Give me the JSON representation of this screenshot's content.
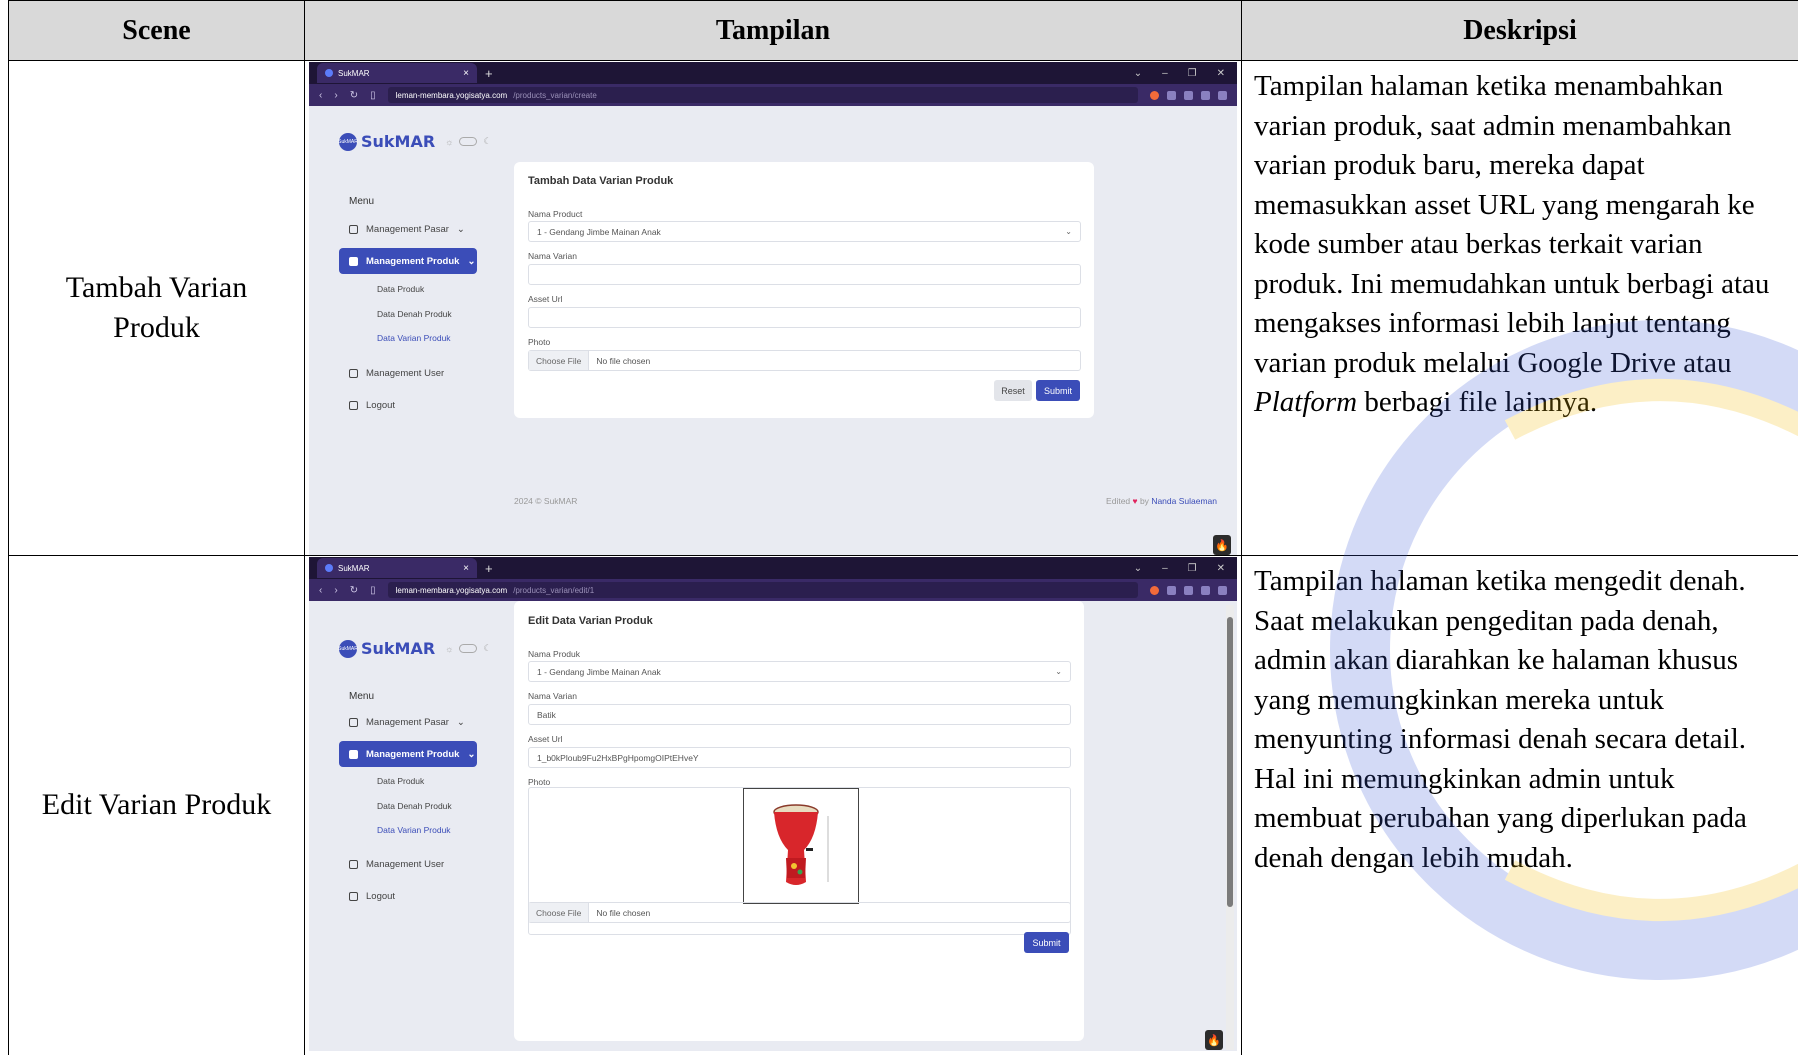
{
  "table": {
    "headers": {
      "scene": "Scene",
      "view": "Tampilan",
      "description": "Deskripsi"
    },
    "rows": [
      {
        "scene": "Tambah Varian Produk",
        "description_parts": [
          "Tampilan halaman ketika menambahkan varian produk, saat admin menambahkan varian produk baru, mereka dapat memasukkan asset URL yang mengarah ke kode sumber atau berkas terkait varian produk. Ini memudahkan untuk berbagi atau mengakses informasi lebih lanjut tentang varian produk melalui Google Drive atau ",
          "Platform",
          " berbagi file lainnya."
        ],
        "screenshot": {
          "tab_title": "SukMAR",
          "url_host": "leman-membara.yogisatya.com",
          "url_path": "/products_varian/create",
          "logo": "SukMAR",
          "menu_title": "Menu",
          "nav": [
            "Management Pasar",
            "Management Produk",
            "Management User",
            "Logout"
          ],
          "subnav": [
            "Data Produk",
            "Data Denah Produk",
            "Data Varian Produk"
          ],
          "card_title": "Tambah Data Varian Produk",
          "labels": [
            "Nama Product",
            "Nama Varian",
            "Asset Url",
            "Photo"
          ],
          "product_value": "1 - Gendang Jimbe Mainan Anak",
          "file_button": "Choose File",
          "file_status": "No file chosen",
          "reset_label": "Reset",
          "submit_label": "Submit",
          "footer_left": "2024 © SukMAR",
          "footer_edited": "Edited",
          "footer_by": "by",
          "footer_author": "Nanda Sulaeman"
        }
      },
      {
        "scene": "Edit Varian Produk",
        "description": "Tampilan halaman ketika mengedit denah. Saat melakukan pengeditan pada denah, admin akan diarahkan ke halaman khusus yang memungkinkan mereka untuk menyunting informasi denah secara detail. Hal ini memungkinkan admin untuk membuat perubahan yang diperlukan pada denah dengan lebih mudah.",
        "screenshot": {
          "tab_title": "SukMAR",
          "url_host": "leman-membara.yogisatya.com",
          "url_path": "/products_varian/edit/1",
          "logo": "SukMAR",
          "menu_title": "Menu",
          "nav": [
            "Management Pasar",
            "Management Produk",
            "Management User",
            "Logout"
          ],
          "subnav": [
            "Data Produk",
            "Data Denah Produk",
            "Data Varian Produk"
          ],
          "card_title": "Edit Data Varian Produk",
          "labels": [
            "Nama Produk",
            "Nama Varian",
            "Asset Url",
            "Photo"
          ],
          "product_value": "1 - Gendang Jimbe Mainan Anak",
          "variant_value": "Batik",
          "asset_value": "1_b0kPloub9Fu2HxBPgHpomgOIPtEHveY",
          "file_button": "Choose File",
          "file_status": "No file chosen",
          "submit_label": "Submit"
        }
      }
    ]
  },
  "colors": {
    "accent": "#3b4db8",
    "browser": "#3a2a66",
    "header_bg": "#d9d9d9"
  }
}
